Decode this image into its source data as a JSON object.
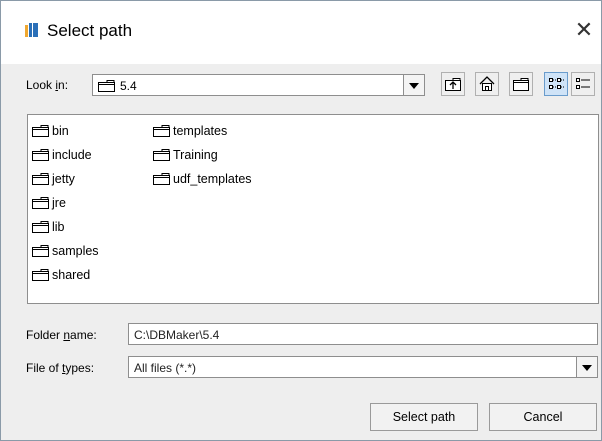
{
  "window": {
    "title": "Select path"
  },
  "lookin": {
    "label_pre": "Look ",
    "label_mn": "i",
    "label_post": "n:",
    "value": "5.4"
  },
  "files": {
    "column1": [
      "bin",
      "include",
      "jetty",
      "jre",
      "lib",
      "samples",
      "shared"
    ],
    "column2": [
      "templates",
      "Training",
      "udf_templates"
    ]
  },
  "folder_name": {
    "label_pre": "Folder ",
    "label_mn": "n",
    "label_post": "ame:",
    "value": "C:\\DBMaker\\5.4"
  },
  "file_types": {
    "label_pre": "File of ",
    "label_mn": "t",
    "label_post": "ypes:",
    "value": "All files (*.*)"
  },
  "buttons": {
    "select": "Select path",
    "cancel": "Cancel"
  },
  "icons": {
    "app": "book-icon",
    "toolbar": [
      "up-folder-icon",
      "home-icon",
      "new-folder-icon",
      "list-view-icon",
      "details-view-icon"
    ]
  }
}
